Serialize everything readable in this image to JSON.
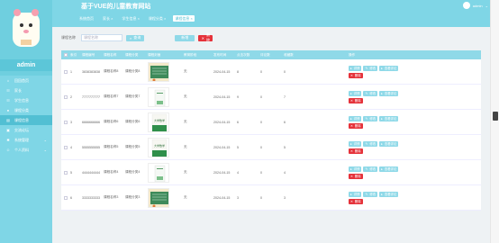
{
  "site": {
    "title": "基于VUE的儿童教育网站"
  },
  "user": {
    "name": "admin"
  },
  "sidebar": {
    "admin_label": "admin",
    "items": [
      {
        "icon": "home-icon",
        "label": "回回首页"
      },
      {
        "icon": "user-icon",
        "label": "家长"
      },
      {
        "icon": "user-icon",
        "label": "学生信息"
      },
      {
        "icon": "user-icon",
        "label": "课程分类"
      },
      {
        "icon": "book-icon",
        "label": "课程信息",
        "active": true
      },
      {
        "icon": "chat-icon",
        "label": "交流论坛"
      },
      {
        "icon": "gear-icon",
        "label": "系统管理",
        "expand": true
      },
      {
        "icon": "person-icon",
        "label": "个人资料",
        "expand": true
      }
    ]
  },
  "nav": {
    "tabs": [
      {
        "label": "系统首页"
      },
      {
        "label": "家长 ×"
      },
      {
        "label": "学生信息 ×"
      },
      {
        "label": "课程分类 ×"
      },
      {
        "label": "课程信息 ×",
        "active": true
      }
    ]
  },
  "search": {
    "label": "课程名称",
    "placeholder": "课程名称",
    "search_button": "查询",
    "add_button": "新增",
    "delete_button": "删除"
  },
  "table": {
    "headers": [
      "",
      "索引",
      "课程编号",
      "课程名称",
      "课程分类",
      "课程封面",
      "教育阶段",
      "发布时间",
      "点击次数",
      "评论数",
      "收藏数",
      "操作"
    ],
    "rows": [
      {
        "index": "1",
        "code": "3838383838",
        "name": "课程名称8",
        "category": "课程分类8",
        "stage": "无",
        "time": "2024-04-15",
        "clicks": "8",
        "comments": "0",
        "fav": "0",
        "cover": "green-chalk"
      },
      {
        "index": "2",
        "code": "7777777777",
        "name": "课程名称7",
        "category": "课程分类7",
        "stage": "无",
        "time": "2024-04-15",
        "clicks": "9",
        "comments": "0",
        "fav": "7",
        "cover": "white-book"
      },
      {
        "index": "3",
        "code": "6666666666",
        "name": "课程名称6",
        "category": "课程分类6",
        "stage": "无",
        "time": "2024-04-15",
        "clicks": "6",
        "comments": "0",
        "fav": "6",
        "cover": "math-book"
      },
      {
        "index": "4",
        "code": "5555555555",
        "name": "课程名称5",
        "category": "课程分类5",
        "stage": "无",
        "time": "2024-04-15",
        "clicks": "5",
        "comments": "0",
        "fav": "5",
        "cover": "math-book"
      },
      {
        "index": "5",
        "code": "4444444444",
        "name": "课程名称4",
        "category": "课程分类4",
        "stage": "无",
        "time": "2024-04-15",
        "clicks": "4",
        "comments": "0",
        "fav": "4",
        "cover": "white-book"
      },
      {
        "index": "6",
        "code": "3333333333",
        "name": "课程名称3",
        "category": "课程分类3",
        "stage": "无",
        "time": "2024-04-15",
        "clicks": "3",
        "comments": "0",
        "fav": "3",
        "cover": "green-chalk"
      }
    ],
    "ops": {
      "view": "详情",
      "edit": "修改",
      "review": "查看评论",
      "delete": "删除"
    },
    "math_cover_text": "大学数学"
  },
  "colors": {
    "accent": "#7fd6e6",
    "danger": "#e5323a",
    "active": "#52bfd3"
  }
}
